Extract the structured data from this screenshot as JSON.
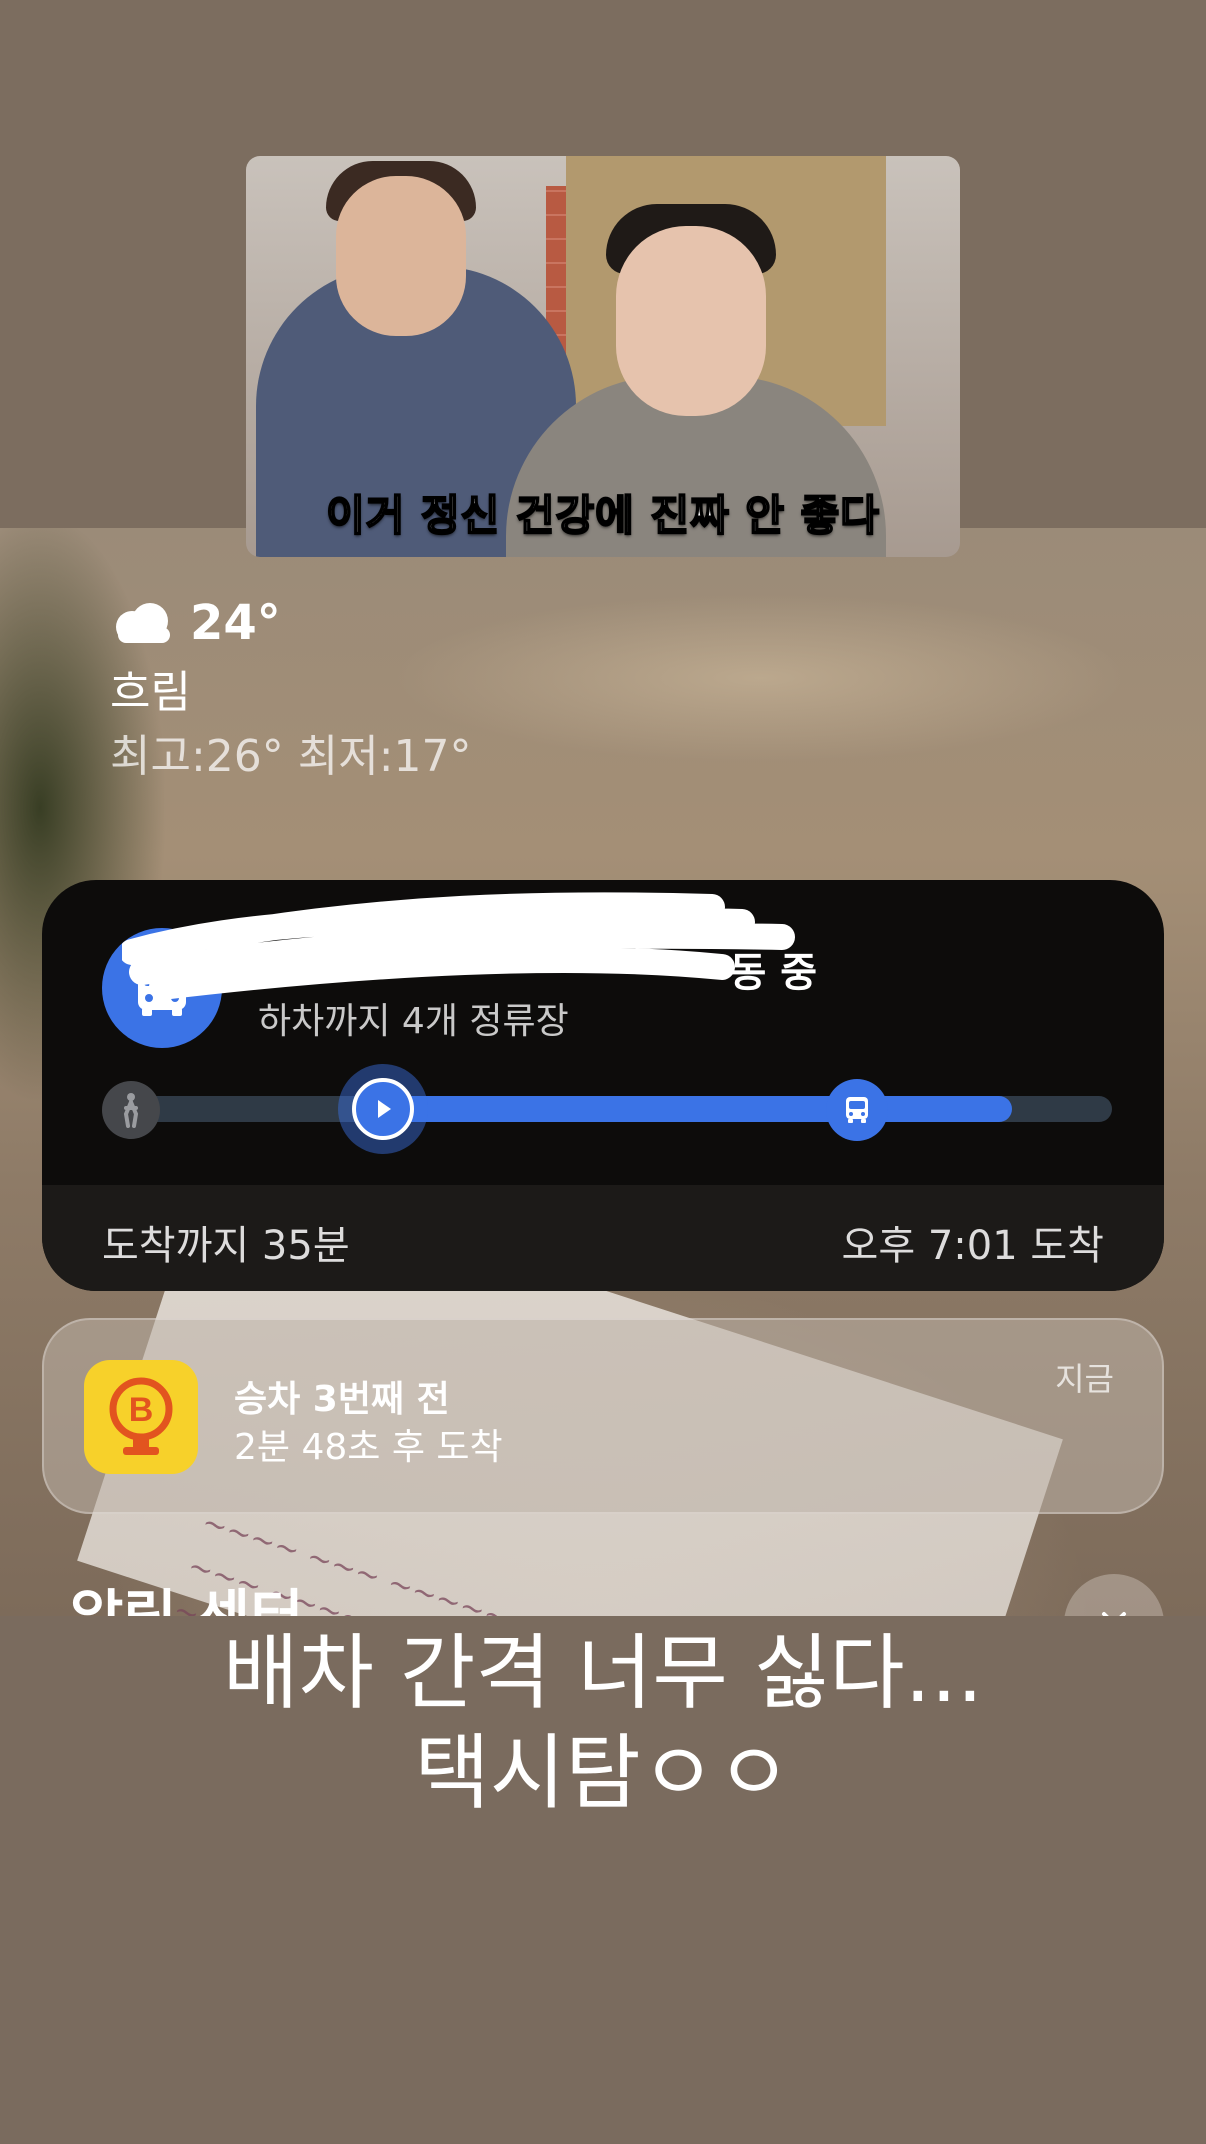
{
  "meme": {
    "logo_text": "",
    "caption": "이거 정신 건강에 진짜 안 좋다"
  },
  "weather": {
    "icon": "cloud-icon",
    "temperature": "24°",
    "condition": "흐림",
    "high_low": "최고:26° 최저:17°"
  },
  "transit_activity": {
    "icon": "bus-icon",
    "title_visible_suffix": "동 중",
    "subtitle": "하차까지 4개 정류장",
    "progress": {
      "current_position_fraction": 0.28,
      "bus_position_fraction": 0.75
    },
    "eta_remaining": "도착까지 35분",
    "arrival_time": "오후 7:01 도착",
    "colors": {
      "accent": "#3b73e6",
      "card_bg": "#0d0c0b"
    }
  },
  "notification": {
    "app_icon": "bus-arrival-app-icon",
    "title": "승차 3번째 전",
    "body": "2분 48초 후 도착",
    "time": "지금"
  },
  "lockscreen": {
    "section_header_partial": "알림 센터",
    "clear_icon": "close-icon"
  },
  "story_caption": {
    "line1": "배차 간격 너무 싫다...",
    "line2": "택시탐ㅇㅇ"
  }
}
